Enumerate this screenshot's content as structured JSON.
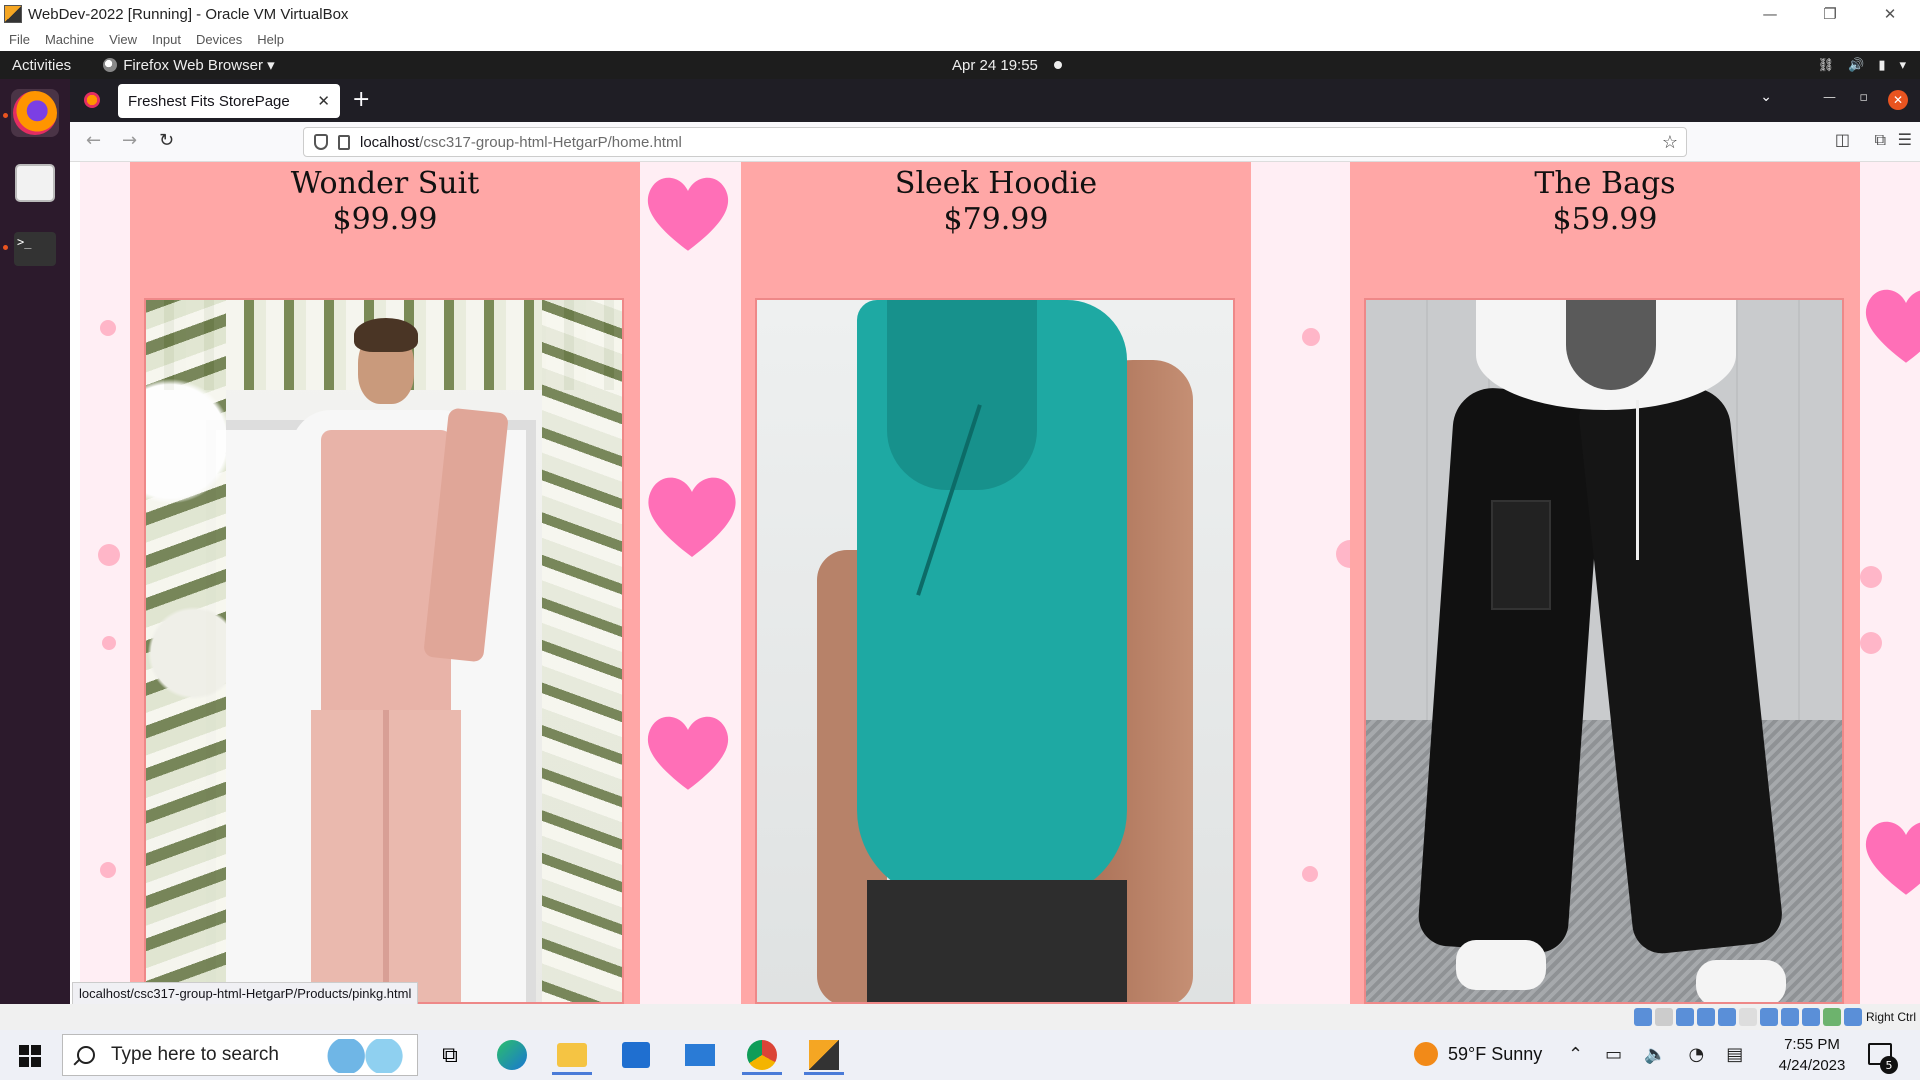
{
  "vbox": {
    "title": "WebDev-2022 [Running] - Oracle VM VirtualBox",
    "menu": [
      "File",
      "Machine",
      "View",
      "Input",
      "Devices",
      "Help"
    ],
    "host_key": "Right Ctrl"
  },
  "gnome": {
    "activities": "Activities",
    "app_menu": "Firefox Web Browser ▾",
    "clock": "Apr 24  19:55"
  },
  "firefox": {
    "tab_title": "Freshest Fits StorePage",
    "url_host": "localhost",
    "url_path": "/csc317-group-html-HetgarP/home.html",
    "status_link": "localhost/csc317-group-html-HetgarP/Products/pinkg.html"
  },
  "products": [
    {
      "name": "Wonder Suit",
      "price": "$99.99"
    },
    {
      "name": "Sleek Hoodie",
      "price": "$79.99"
    },
    {
      "name": "The Bags",
      "price": "$59.99"
    }
  ],
  "taskbar": {
    "search_placeholder": "Type here to search",
    "weather": "59°F  Sunny",
    "time": "7:55 PM",
    "date": "4/24/2023",
    "notification_count": "5"
  },
  "colors": {
    "card_bg": "#ffa7a6",
    "page_bg": "#ffeef4",
    "heart": "#ff6fb7"
  }
}
